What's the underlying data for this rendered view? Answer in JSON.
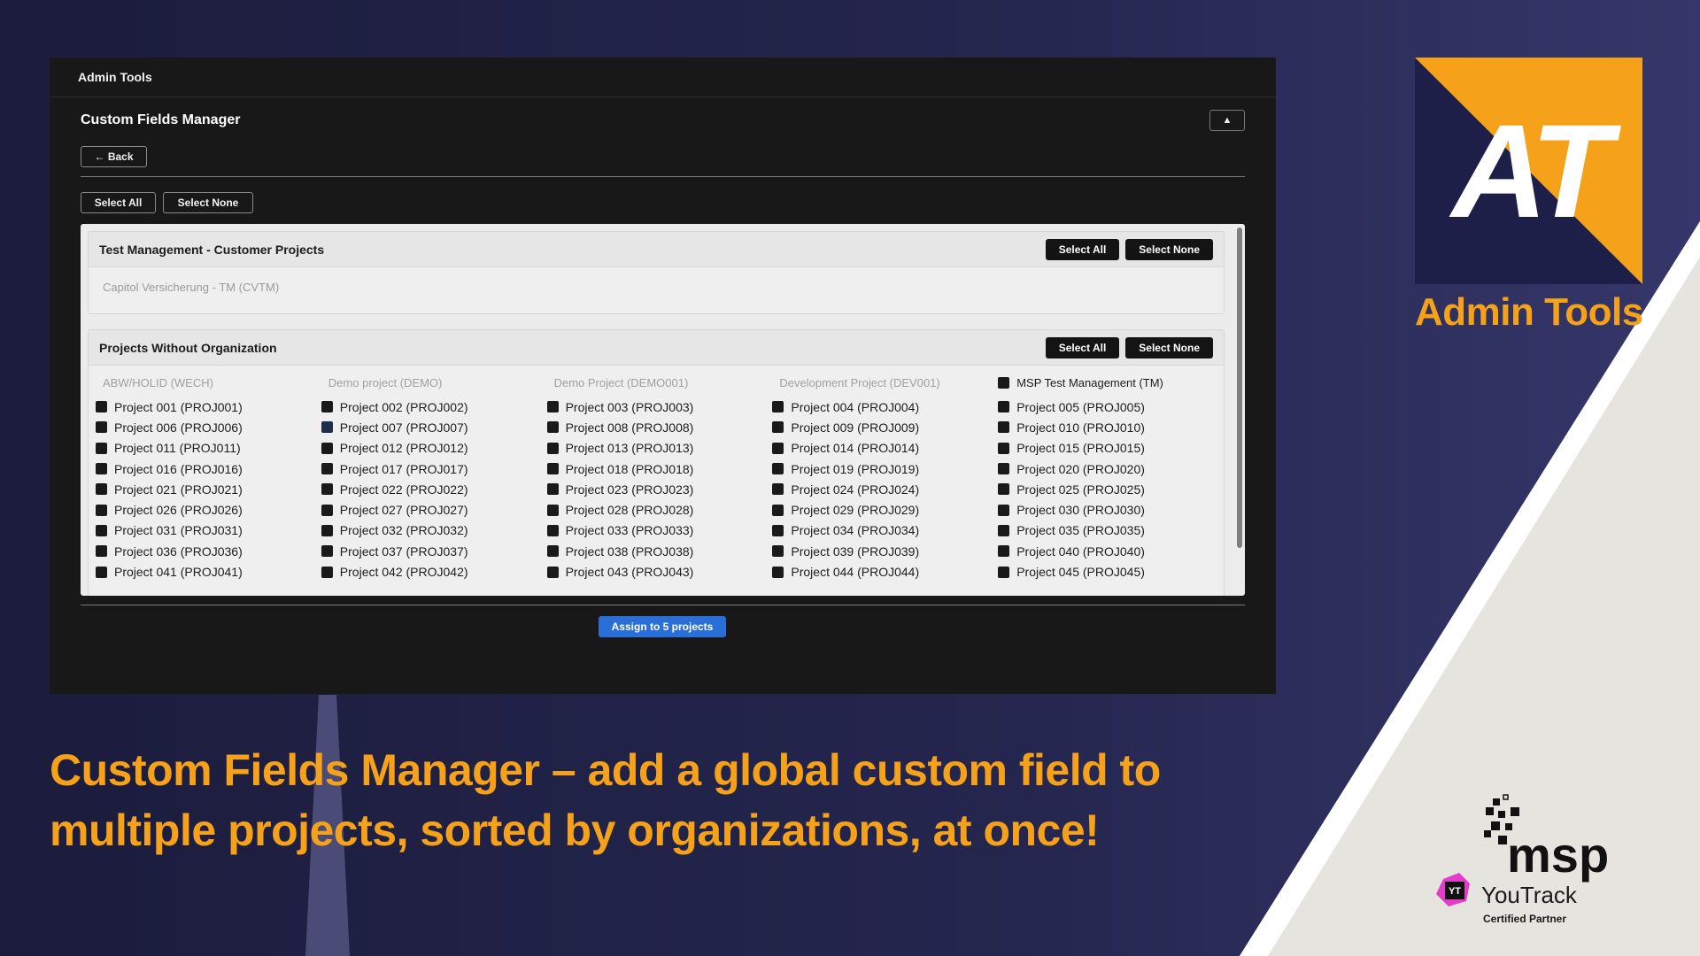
{
  "window": {
    "header_title": "Admin Tools",
    "panel_title": "Custom Fields Manager",
    "collapse_label": "▲",
    "back_label": "← Back",
    "select_all_label": "Select All",
    "select_none_label": "Select None",
    "assign_label": "Assign to 5 projects"
  },
  "groups": [
    {
      "title": "Test Management - Customer Projects",
      "select_all": "Select All",
      "select_none": "Select None",
      "org": "Capitol Versicherung - TM (CVTM)"
    },
    {
      "title": "Projects Without Organization",
      "select_all": "Select All",
      "select_none": "Select None",
      "columns": [
        {
          "head": "ABW/HOLID (WECH)",
          "items": [
            "Project 001 (PROJ001)",
            "Project 006 (PROJ006)",
            "Project 011 (PROJ011)",
            "Project 016 (PROJ016)",
            "Project 021 (PROJ021)",
            "Project 026 (PROJ026)",
            "Project 031 (PROJ031)",
            "Project 036 (PROJ036)",
            "Project 041 (PROJ041)"
          ]
        },
        {
          "head": "Demo project (DEMO)",
          "items": [
            "Project 002 (PROJ002)",
            "Project 007 (PROJ007)",
            "Project 012 (PROJ012)",
            "Project 017 (PROJ017)",
            "Project 022 (PROJ022)",
            "Project 027 (PROJ027)",
            "Project 032 (PROJ032)",
            "Project 037 (PROJ037)",
            "Project 042 (PROJ042)"
          ]
        },
        {
          "head": "Demo Project (DEMO001)",
          "items": [
            "Project 003 (PROJ003)",
            "Project 008 (PROJ008)",
            "Project 013 (PROJ013)",
            "Project 018 (PROJ018)",
            "Project 023 (PROJ023)",
            "Project 028 (PROJ028)",
            "Project 033 (PROJ033)",
            "Project 038 (PROJ038)",
            "Project 043 (PROJ043)"
          ]
        },
        {
          "head": "Development Project (DEV001)",
          "items": [
            "Project 004 (PROJ004)",
            "Project 009 (PROJ009)",
            "Project 014 (PROJ014)",
            "Project 019 (PROJ019)",
            "Project 024 (PROJ024)",
            "Project 029 (PROJ029)",
            "Project 034 (PROJ034)",
            "Project 039 (PROJ039)",
            "Project 044 (PROJ044)"
          ]
        },
        {
          "head": "MSP Test Management (TM)",
          "items": [
            "Project 005 (PROJ005)",
            "Project 010 (PROJ010)",
            "Project 015 (PROJ015)",
            "Project 020 (PROJ020)",
            "Project 025 (PROJ025)",
            "Project 030 (PROJ030)",
            "Project 035 (PROJ035)",
            "Project 040 (PROJ040)",
            "Project 045 (PROJ045)"
          ]
        }
      ]
    }
  ],
  "branding": {
    "logo_letters": "AT",
    "logo_caption": "Admin Tools",
    "headline": "Custom Fields Manager – add a global custom field to multiple projects, sorted by organizations, at once!",
    "msp_text": "msp",
    "yt_badge": "YT",
    "youtrack_text": "YouTrack",
    "certified_text": "Certified Partner",
    "accent_color": "#f5a21a",
    "navy_color": "#1e1f48"
  }
}
